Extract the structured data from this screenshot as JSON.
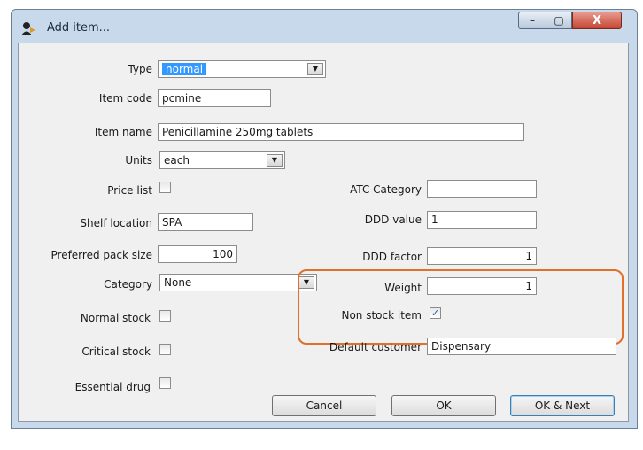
{
  "window": {
    "title": "Add item...",
    "controls": {
      "minimize": "–",
      "maximize": "▢",
      "close": "X"
    }
  },
  "form": {
    "type": {
      "label": "Type",
      "value": "normal"
    },
    "item_code": {
      "label": "Item code",
      "value": "pcmine"
    },
    "item_name": {
      "label": "Item name",
      "value": "Penicillamine 250mg tablets"
    },
    "units": {
      "label": "Units",
      "value": "each"
    },
    "price_list": {
      "label": "Price list",
      "checked": false
    },
    "shelf_location": {
      "label": "Shelf location",
      "value": "SPA"
    },
    "preferred_pack_size": {
      "label": "Preferred pack size",
      "value": "100"
    },
    "category": {
      "label": "Category",
      "value": "None"
    },
    "normal_stock": {
      "label": "Normal stock",
      "checked": false
    },
    "critical_stock": {
      "label": "Critical stock",
      "checked": false
    },
    "essential_drug": {
      "label": "Essential drug",
      "checked": false
    },
    "atc_category": {
      "label": "ATC Category",
      "value": ""
    },
    "ddd_value": {
      "label": "DDD value",
      "value": "1"
    },
    "ddd_factor": {
      "label": "DDD factor",
      "value": "1"
    },
    "weight": {
      "label": "Weight",
      "value": "1"
    },
    "non_stock_item": {
      "label": "Non stock item",
      "checked": true,
      "mark": "✓"
    },
    "default_customer": {
      "label": "Default customer",
      "value": "Dispensary"
    }
  },
  "buttons": {
    "cancel": "Cancel",
    "ok": "OK",
    "ok_next": "OK & Next"
  },
  "colors": {
    "highlight": "#e0702b",
    "selection": "#3399ff",
    "title_bar": "#c9d9ec"
  },
  "icons": {
    "app": "app-person-icon",
    "dropdown": "chevron-down-icon"
  }
}
